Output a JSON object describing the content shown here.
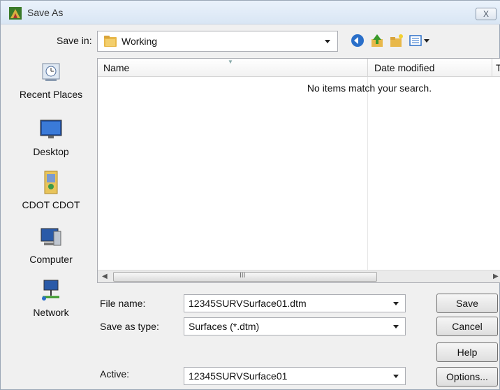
{
  "window": {
    "title": "Save As",
    "close_label": "X"
  },
  "save_in": {
    "label": "Save in:",
    "value": "Working"
  },
  "toolbar": {
    "icons": [
      "back-icon",
      "up-folder-icon",
      "new-folder-icon",
      "views-menu-icon"
    ]
  },
  "places": [
    {
      "label": "Recent Places",
      "icon": "recent-places-icon"
    },
    {
      "label": "Desktop",
      "icon": "desktop-icon"
    },
    {
      "label": "CDOT CDOT",
      "icon": "user-folder-icon"
    },
    {
      "label": "Computer",
      "icon": "computer-icon"
    },
    {
      "label": "Network",
      "icon": "network-icon"
    }
  ],
  "file_list": {
    "columns": [
      "Name",
      "Date modified",
      "T"
    ],
    "empty_message": "No items match your search.",
    "scroll_grip": "III"
  },
  "form": {
    "file_name": {
      "label": "File name:",
      "value": "12345SURVSurface01.dtm"
    },
    "save_as_type": {
      "label": "Save as type:",
      "value": "Surfaces (*.dtm)"
    },
    "active": {
      "label": "Active:",
      "value": "12345SURVSurface01"
    }
  },
  "buttons": {
    "save": "Save",
    "cancel": "Cancel",
    "help": "Help",
    "options": "Options..."
  },
  "colors": {
    "title_bar": "#dbe7f5",
    "folder": "#e8b84a",
    "accent_blue": "#2a6fc9"
  }
}
